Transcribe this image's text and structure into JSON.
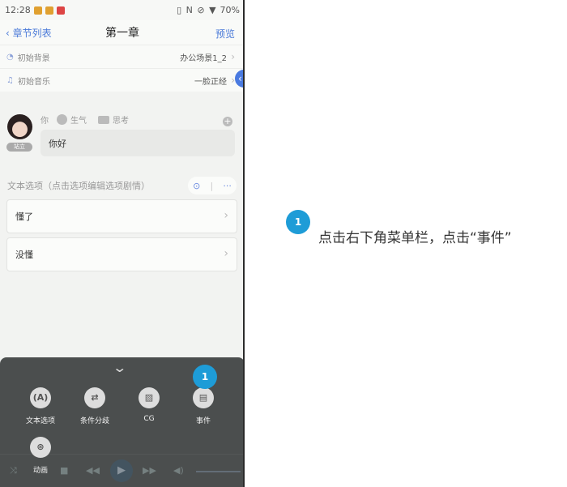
{
  "status_bar": {
    "time": "12:28",
    "battery": "70%"
  },
  "header": {
    "back_label": "章节列表",
    "title": "第一章",
    "preview_label": "预览"
  },
  "settings": [
    {
      "label": "初始背景",
      "value": "办公场景1_2",
      "icon": "landscape-icon"
    },
    {
      "label": "初始音乐",
      "value": "一脸正经",
      "icon": "headphones-icon"
    }
  ],
  "dialog": {
    "speaker": "你",
    "emotion": "生气",
    "mode": "思考",
    "avatar_tag": "站立",
    "text": "你好"
  },
  "options_section": {
    "label": "文本选项（点击选项编辑选项剧情）",
    "items": [
      "懂了",
      "没懂"
    ]
  },
  "sheet_menu": {
    "items": [
      {
        "label": "文本选项",
        "icon": "text-option-icon",
        "glyph": "(A)"
      },
      {
        "label": "条件分歧",
        "icon": "branch-icon",
        "glyph": "⇄"
      },
      {
        "label": "CG",
        "icon": "image-icon",
        "glyph": "▨"
      },
      {
        "label": "事件",
        "icon": "event-camera-icon",
        "glyph": "▤"
      },
      {
        "label": "动画",
        "icon": "film-reel-icon",
        "glyph": "⊛"
      }
    ]
  },
  "step": {
    "number": "1",
    "instruction": "点击右下角菜单栏，点击“事件”",
    "color": "#1e9cd7"
  }
}
